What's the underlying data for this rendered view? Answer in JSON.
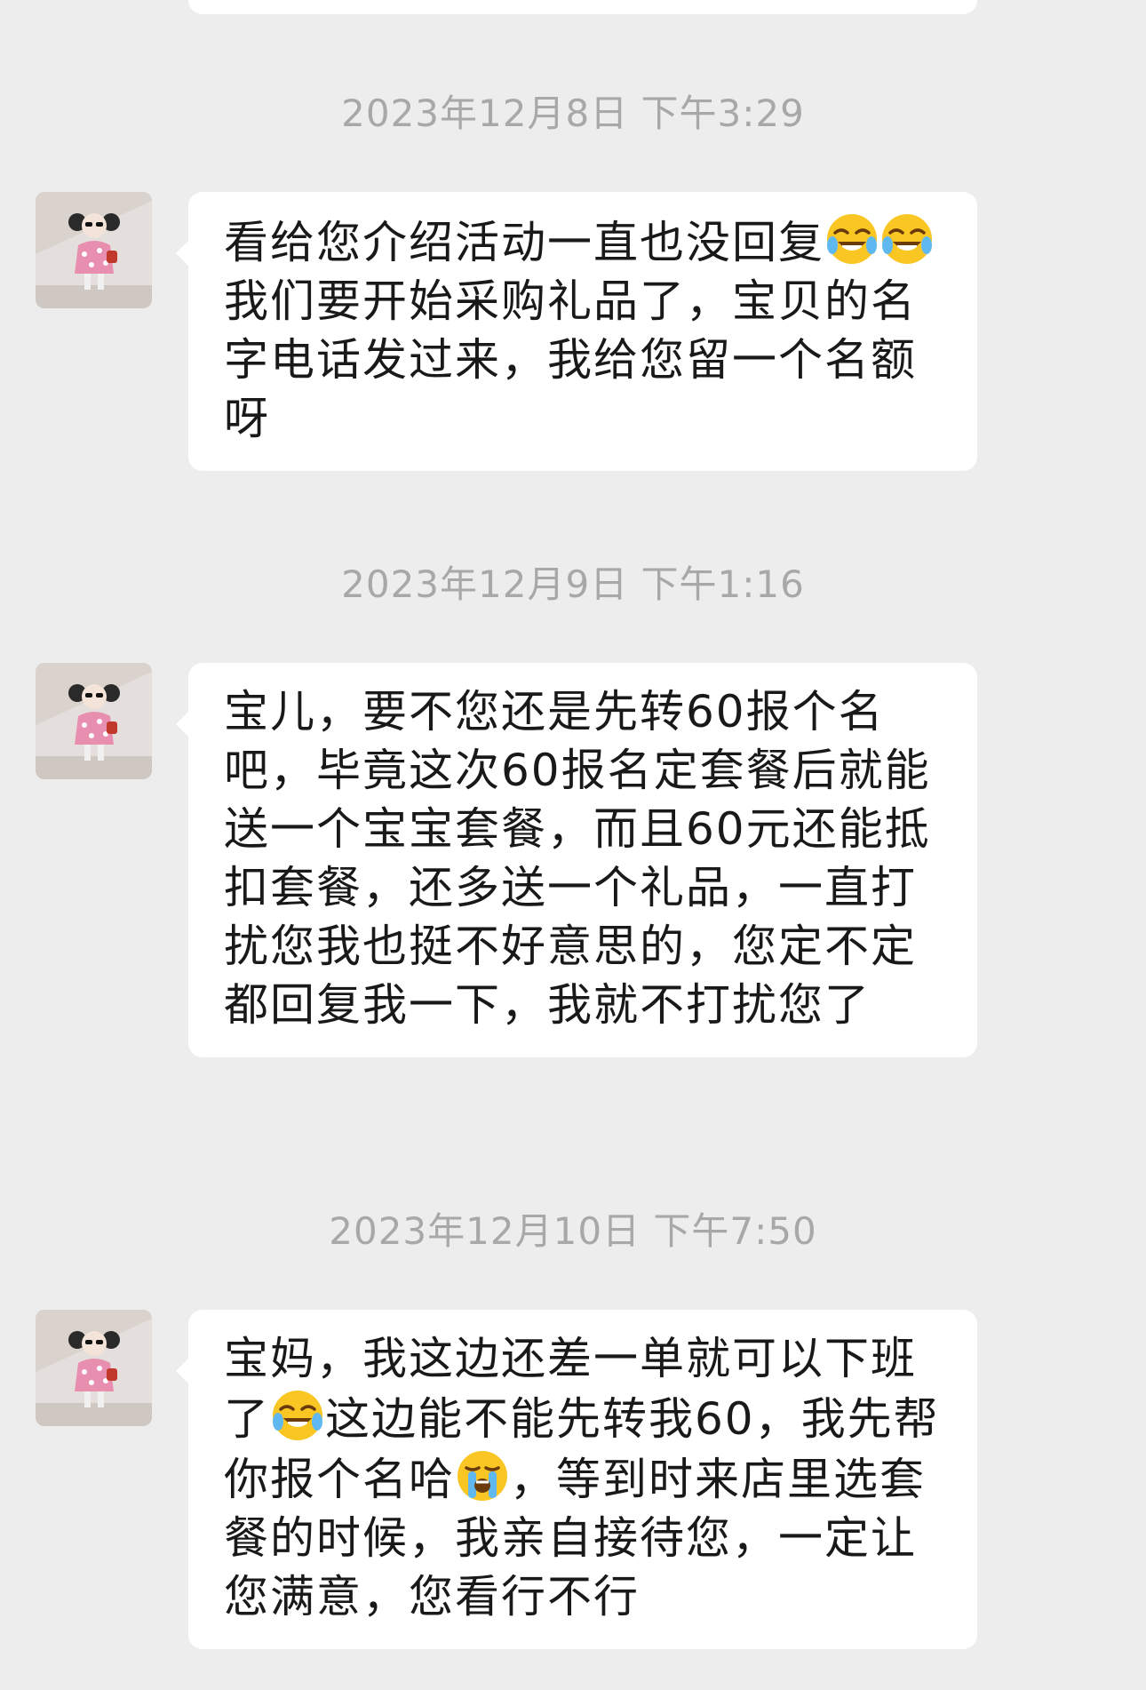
{
  "conversation": {
    "messages": [
      {
        "timestamp": "2023年12月8日 下午3:29",
        "parts": [
          {
            "text": " 看给您介绍活动一直也没回复"
          },
          {
            "emoji": "laughing-tears-emoji"
          },
          {
            "emoji": "laughing-tears-emoji"
          },
          {
            "text": "我们要开始采购礼品了，宝贝的名字电话发过来，我给您留一个名额呀"
          }
        ]
      },
      {
        "timestamp": "2023年12月9日 下午1:16",
        "parts": [
          {
            "text": "宝儿，要不您还是先转60报个名吧，毕竟这次60报名定套餐后就能送一个宝宝套餐，而且60元还能抵扣套餐，还多送一个礼品，一直打扰您我也挺不好意思的，您定不定都回复我一下，我就不打扰您了"
          }
        ]
      },
      {
        "timestamp": "2023年12月10日 下午7:50",
        "parts": [
          {
            "text": "宝妈，我这边还差一单就可以下班了"
          },
          {
            "emoji": "laughing-tears-emoji"
          },
          {
            "text": "这边能不能先转我60，我先帮你报个名哈"
          },
          {
            "emoji": "crying-emoji"
          },
          {
            "text": "，等到时来店里选套餐的时候，我亲自接待您，一定让您满意，您看行不行"
          }
        ]
      }
    ]
  },
  "colors": {
    "background": "#ededed",
    "bubble": "#ffffff",
    "text": "#191919",
    "timestamp": "#a8a8a8"
  }
}
